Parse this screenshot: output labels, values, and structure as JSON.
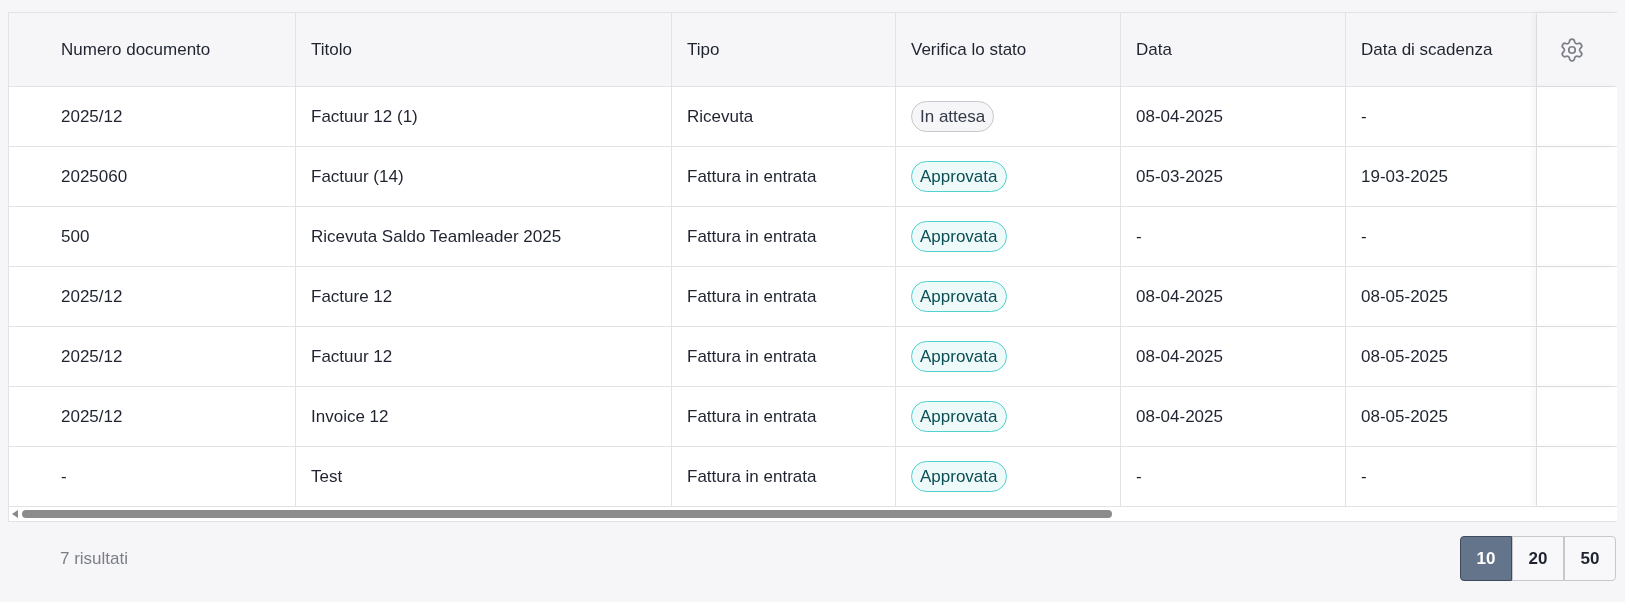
{
  "table": {
    "columns": [
      "Numero documento",
      "Titolo",
      "Tipo",
      "Verifica lo stato",
      "Data",
      "Data di scadenza"
    ],
    "rows": [
      {
        "number": "2025/12",
        "title": "Factuur 12 (1)",
        "type": "Ricevuta",
        "status": {
          "label": "In attesa",
          "kind": "pending"
        },
        "date": "08-04-2025",
        "due": "-"
      },
      {
        "number": "2025060",
        "title": "Factuur (14)",
        "type": "Fattura in entrata",
        "status": {
          "label": "Approvata",
          "kind": "approved"
        },
        "date": "05-03-2025",
        "due": "19-03-2025"
      },
      {
        "number": "500",
        "title": "Ricevuta Saldo Teamleader 2025",
        "type": "Fattura in entrata",
        "status": {
          "label": "Approvata",
          "kind": "approved"
        },
        "date": "-",
        "due": "-"
      },
      {
        "number": "2025/12",
        "title": "Facture 12",
        "type": "Fattura in entrata",
        "status": {
          "label": "Approvata",
          "kind": "approved"
        },
        "date": "08-04-2025",
        "due": "08-05-2025"
      },
      {
        "number": "2025/12",
        "title": "Factuur 12",
        "type": "Fattura in entrata",
        "status": {
          "label": "Approvata",
          "kind": "approved"
        },
        "date": "08-04-2025",
        "due": "08-05-2025"
      },
      {
        "number": "2025/12",
        "title": "Invoice 12",
        "type": "Fattura in entrata",
        "status": {
          "label": "Approvata",
          "kind": "approved"
        },
        "date": "08-04-2025",
        "due": "08-05-2025"
      },
      {
        "number": "-",
        "title": "Test",
        "type": "Fattura in entrata",
        "status": {
          "label": "Approvata",
          "kind": "approved"
        },
        "date": "-",
        "due": "-"
      }
    ]
  },
  "footer": {
    "results": "7 risultati",
    "page_sizes": [
      {
        "label": "10",
        "selected": true
      },
      {
        "label": "20",
        "selected": false
      },
      {
        "label": "50",
        "selected": false
      }
    ]
  }
}
